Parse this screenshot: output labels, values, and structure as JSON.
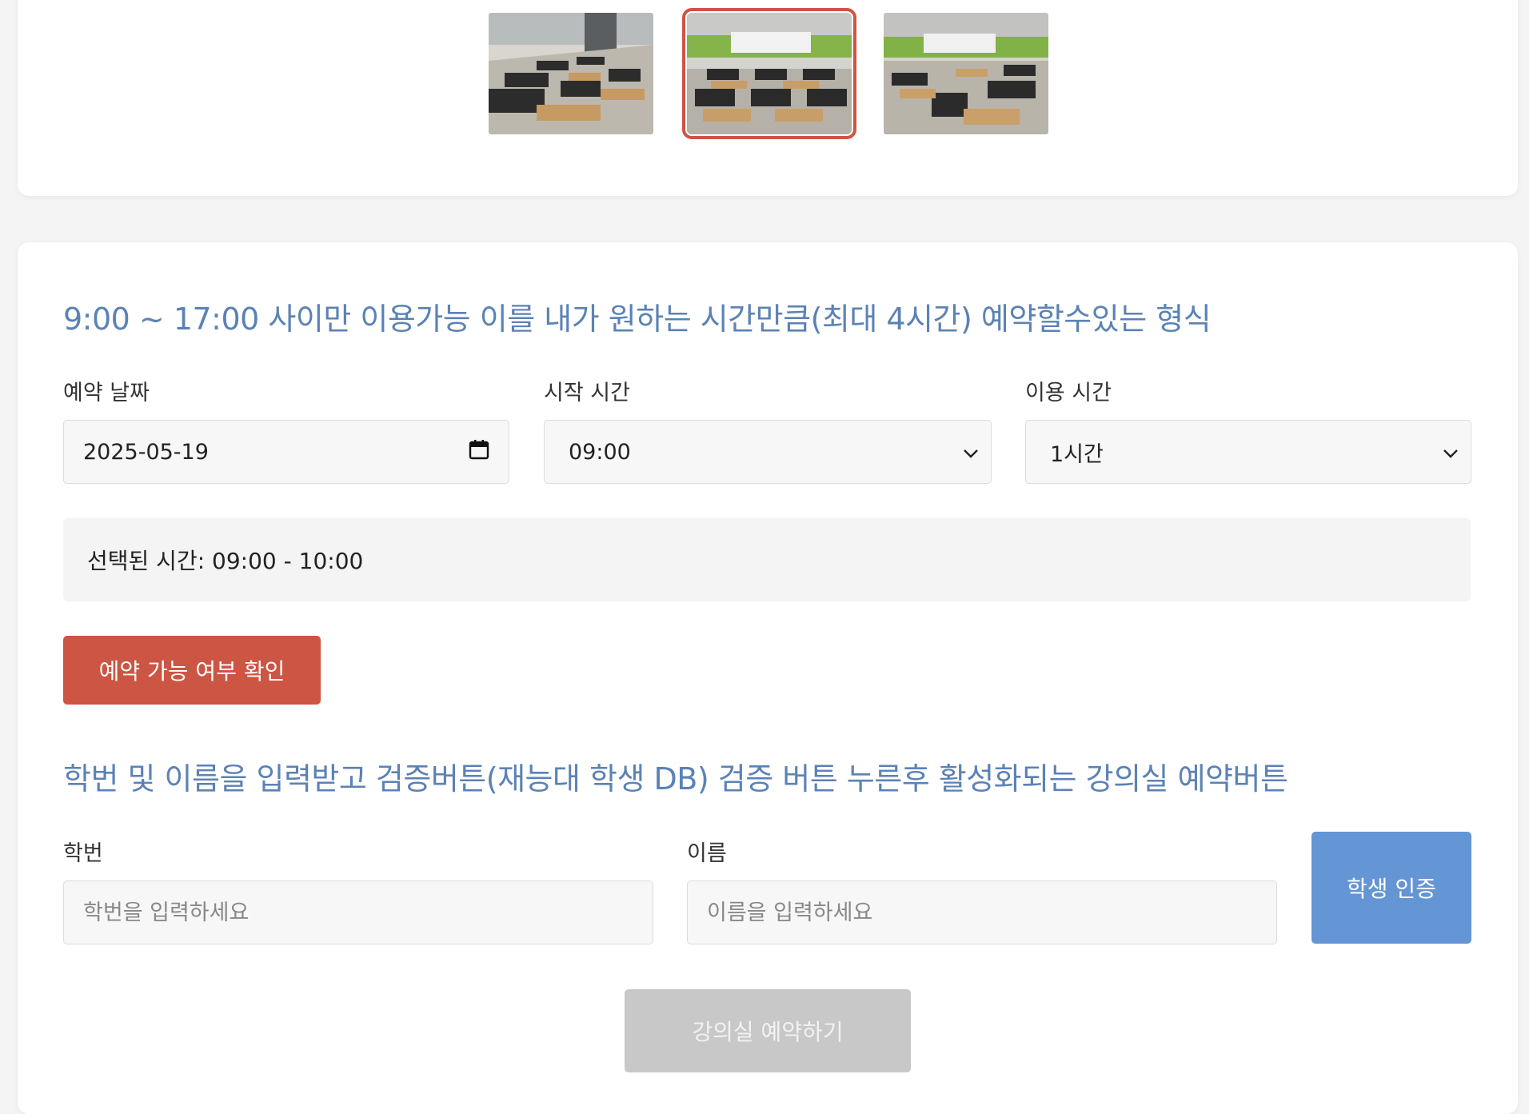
{
  "gallery": {
    "thumbnails": [
      {
        "alt": "classroom-photo-1",
        "active": false
      },
      {
        "alt": "classroom-photo-2",
        "active": true
      },
      {
        "alt": "classroom-photo-3",
        "active": false
      }
    ]
  },
  "booking": {
    "title": "9:00 ~ 17:00 사이만 이용가능 이를 내가 원하는 시간만큼(최대 4시간) 예약할수있는 형식",
    "date_label": "예약 날짜",
    "date_value": "2025-05-19",
    "start_label": "시작 시간",
    "start_value": "09:00",
    "duration_label": "이용 시간",
    "duration_value": "1시간",
    "selected_time": "선택된 시간: 09:00 - 10:00",
    "check_button": "예약 가능 여부 확인"
  },
  "student": {
    "title": "학번 및 이름을 입력받고 검증버튼(재능대 학생 DB) 검증 버튼 누른후 활성화되는 강의실 예약버튼",
    "id_label": "학번",
    "id_placeholder": "학번을 입력하세요",
    "name_label": "이름",
    "name_placeholder": "이름을 입력하세요",
    "auth_button": "학생 인증",
    "reserve_button": "강의실 예약하기"
  },
  "colors": {
    "accent_red": "#cc5544",
    "accent_blue": "#6495d5",
    "title_blue": "#5b82b5",
    "disabled_gray": "#c8c8c8"
  }
}
